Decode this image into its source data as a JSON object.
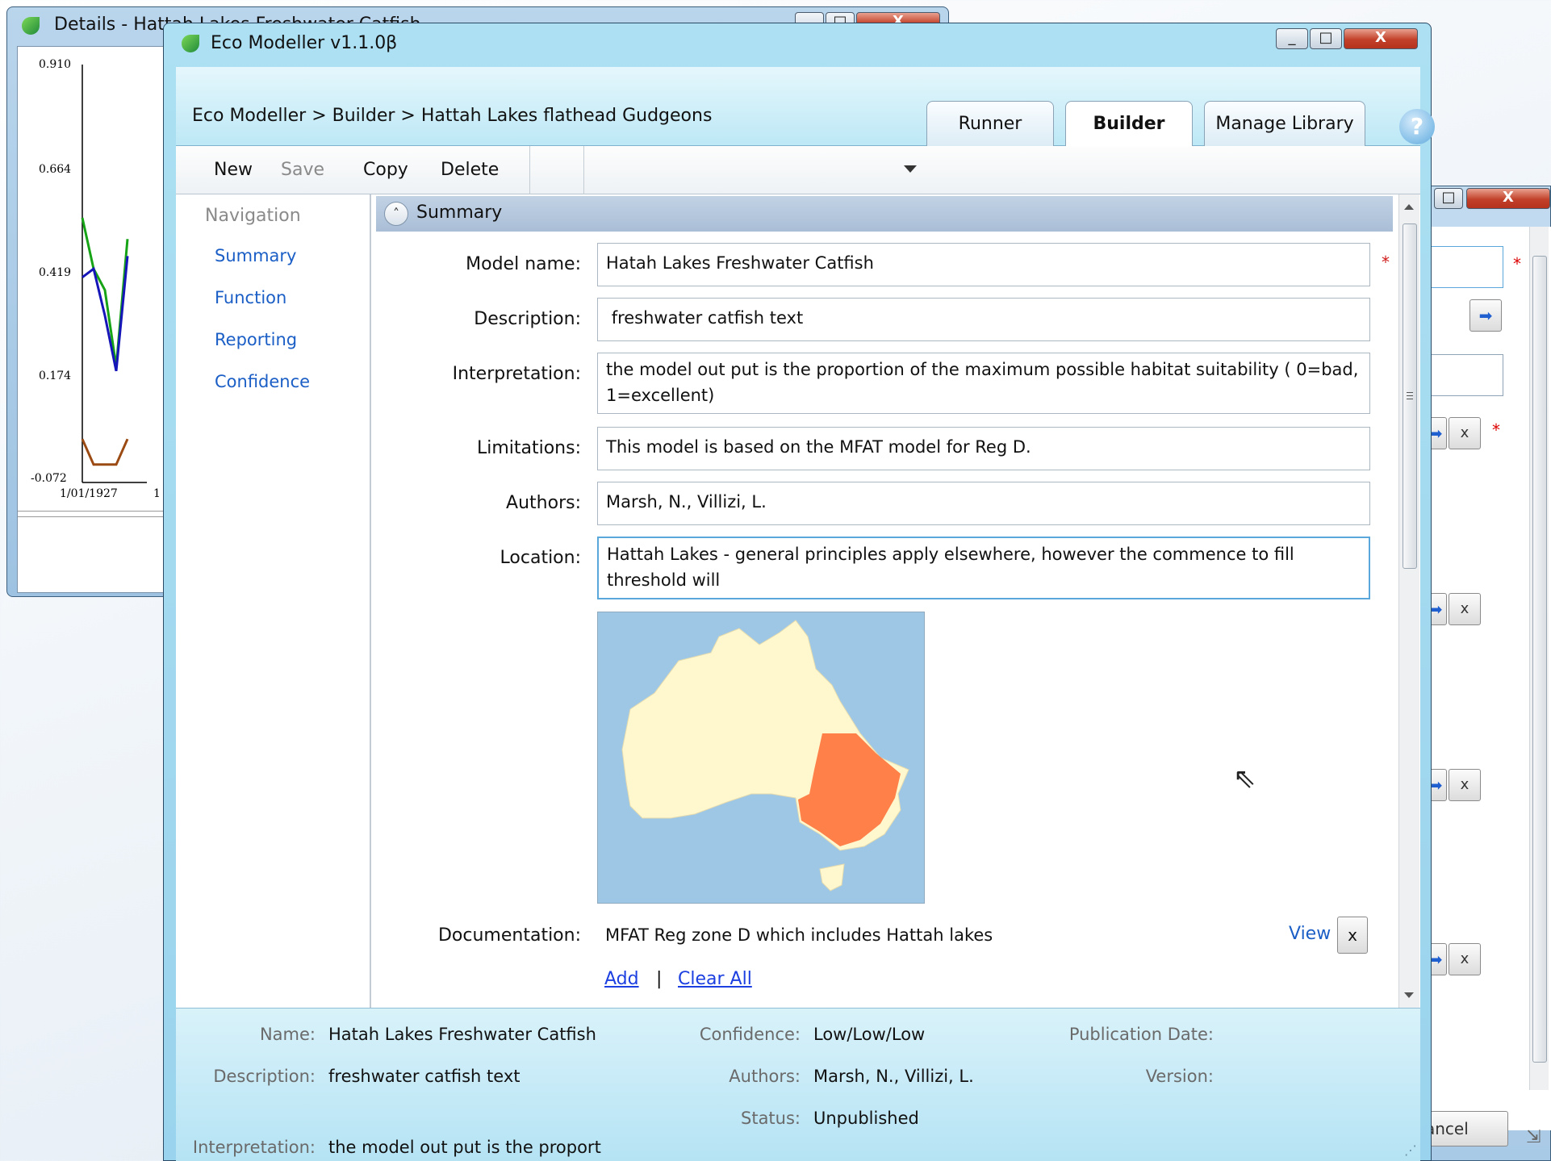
{
  "details_window": {
    "title": "Details - Hattah Lakes Freshwater Catfish",
    "chart": {
      "y_ticks": [
        "0.910",
        "0.664",
        "0.419",
        "0.174",
        "-0.072"
      ],
      "x_ticks": [
        "1/01/1927",
        "1"
      ]
    }
  },
  "chart_data": {
    "type": "line",
    "title": "",
    "xlabel": "",
    "ylabel": "",
    "ylim": [
      -0.072,
      0.91
    ],
    "x": [
      "1/01/1927",
      "",
      "",
      "",
      ""
    ],
    "series": [
      {
        "values": [
          0.55,
          0.43,
          0.38,
          0.2,
          0.5
        ],
        "color": "#16a316"
      },
      {
        "values": [
          0.41,
          0.43,
          0.32,
          0.19,
          0.46
        ],
        "color": "#1515b8"
      },
      {
        "values": [
          0.03,
          -0.03,
          -0.03,
          -0.03,
          0.03
        ],
        "color": "#9a4a12"
      }
    ]
  },
  "main_window": {
    "title": "Eco Modeller v1.1.0β",
    "breadcrumb": "Eco Modeller > Builder > Hattah Lakes flathead Gudgeons",
    "tabs": [
      {
        "label": "Runner",
        "active": false
      },
      {
        "label": "Builder",
        "active": true
      },
      {
        "label": "Manage Library",
        "active": false
      }
    ],
    "help_label": "?",
    "toolbar": {
      "new": "New",
      "save": "Save",
      "copy": "Copy",
      "delete": "Delete"
    }
  },
  "navigation": {
    "heading": "Navigation",
    "items": [
      "Summary",
      "Function",
      "Reporting",
      "Confidence"
    ]
  },
  "summary": {
    "section_title": "Summary",
    "required_marker": "*",
    "model_name": {
      "label": "Model name:",
      "value": "Hatah Lakes Freshwater Catfish"
    },
    "description": {
      "label": "Description:",
      "value": " freshwater catfish text"
    },
    "interpretation": {
      "label": "Interpretation:",
      "value": "the model out put is the proportion of the maximum possible habitat suitability ( 0=bad, 1=excellent)"
    },
    "limitations": {
      "label": "Limitations:",
      "value": "This model is based on the MFAT model for Reg D."
    },
    "authors": {
      "label": "Authors:",
      "value": "Marsh, N., Villizi, L."
    },
    "location": {
      "label": "Location:",
      "value": "Hattah Lakes - general principles apply elsewhere, however the commence to fill threshold will"
    },
    "documentation": {
      "label": "Documentation:",
      "value": "MFAT Reg zone D which includes Hattah lakes",
      "view": "View",
      "remove": "x",
      "add": "Add",
      "separator": "|",
      "clear_all": "Clear All"
    },
    "map_colors": {
      "sea": "#9ec7e6",
      "land": "#fff8cf",
      "highlight": "#ff8149"
    }
  },
  "footer": {
    "name_label": "Name:",
    "name_value": "Hatah Lakes Freshwater Catfish",
    "description_label": "Description:",
    "description_value": "freshwater catfish text",
    "interpretation_label": "Interpretation:",
    "interpretation_value": "the model out put is the proport",
    "confidence_label": "Confidence:",
    "confidence_value": "Low/Low/Low",
    "authors_label": "Authors:",
    "authors_value": "Marsh, N., Villizi, L.",
    "status_label": "Status:",
    "status_value": "Unpublished",
    "publication_date_label": "Publication Date:",
    "version_label": "Version:"
  },
  "right_window": {
    "cancel_label": "ancel",
    "remove_label": "x",
    "required_marker": "*"
  }
}
